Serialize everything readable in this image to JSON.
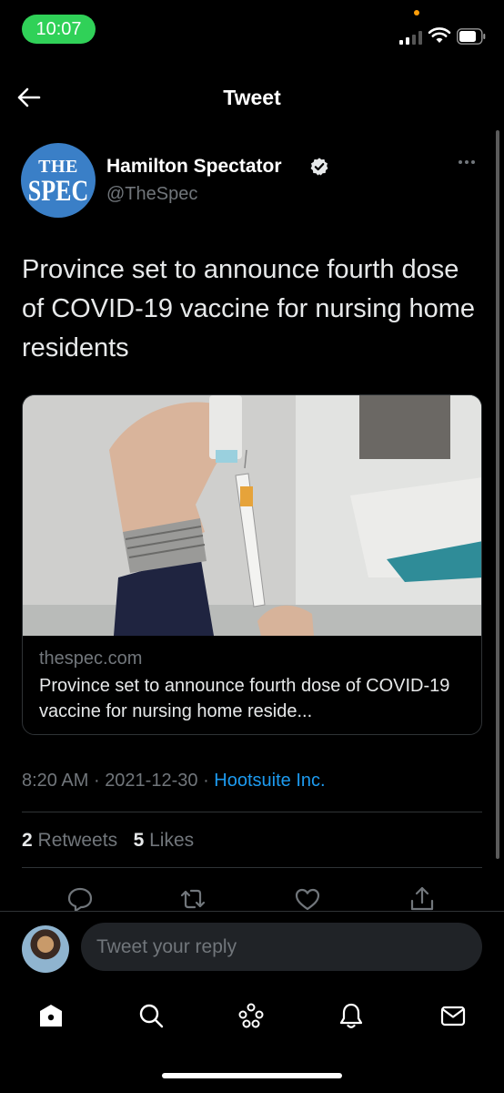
{
  "status_bar": {
    "time": "10:07"
  },
  "header": {
    "title": "Tweet",
    "back_icon": "arrow-left-icon"
  },
  "tweet": {
    "author": {
      "name": "Hamilton Spectator",
      "handle": "@TheSpec",
      "avatar_line1": "THE",
      "avatar_line2": "SPEC",
      "avatar_color": "#3a7fc7",
      "verified": true
    },
    "text": "Province set to announce fourth dose of COVID-19 vaccine for nursing home residents",
    "card": {
      "domain": "thespec.com",
      "title": "Province set to announce fourth dose of COVID-19 vaccine for nursing home reside..."
    },
    "time": "8:20 AM",
    "date": "2021-12-30",
    "source": "Hootsuite Inc.",
    "separator": "·",
    "retweets_count": "2",
    "retweets_label": "Retweets",
    "likes_count": "5",
    "likes_label": "Likes"
  },
  "actions": [
    "reply-icon",
    "retweet-icon",
    "like-icon",
    "share-icon"
  ],
  "reply": {
    "placeholder": "Tweet your reply"
  },
  "bottom_nav": [
    "home-icon",
    "search-icon",
    "spaces-icon",
    "notifications-icon",
    "messages-icon"
  ],
  "colors": {
    "background": "#000000",
    "accent": "#1d9bf0",
    "secondary_text": "#71767b",
    "status_time_pill": "#30d158"
  }
}
